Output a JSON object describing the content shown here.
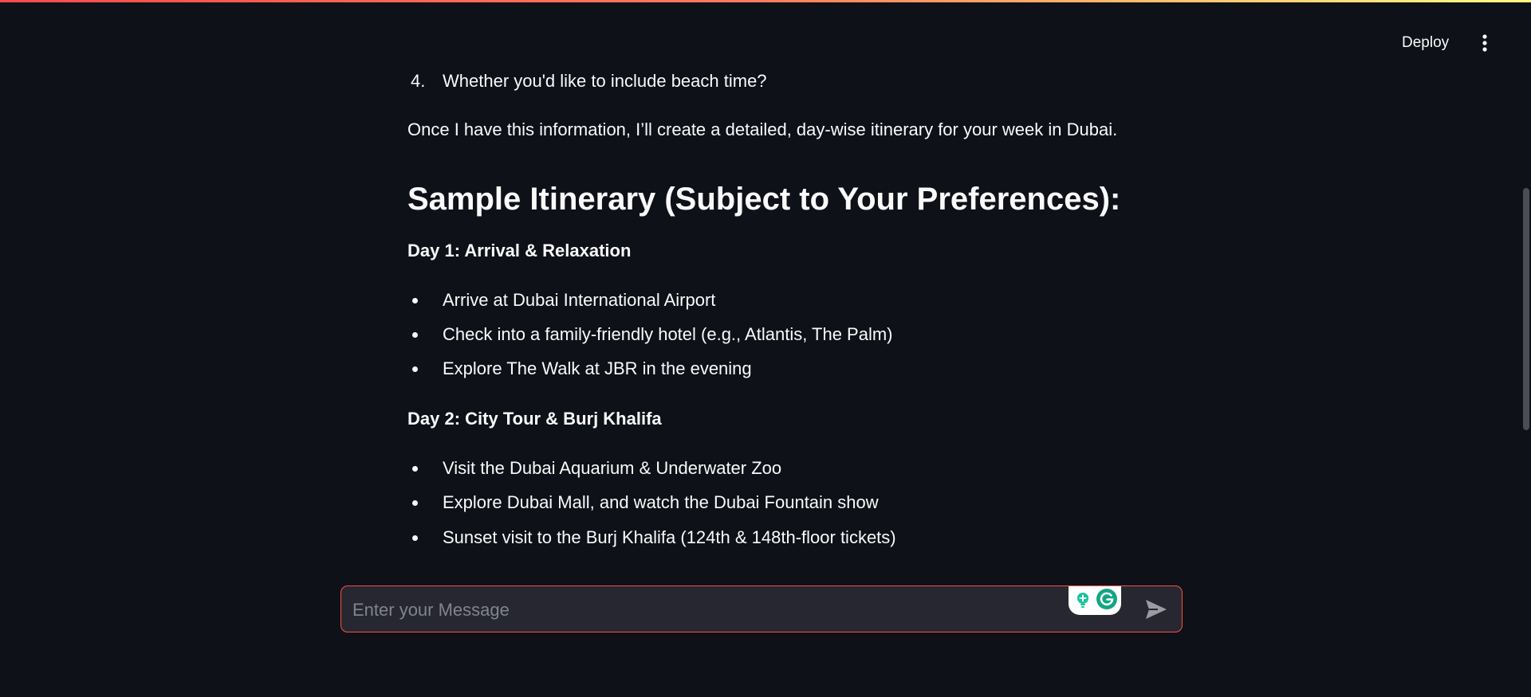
{
  "header": {
    "deploy_label": "Deploy",
    "menu_icon": "vertical-ellipsis-icon"
  },
  "colors": {
    "background": "#0e1117",
    "text": "#fafafa",
    "accent": "#ff4b4b",
    "input_bg": "#262730",
    "placeholder": "#80848e"
  },
  "chat": {
    "ordered_item": {
      "number": "4.",
      "text": "Whether you'd like to include beach time?"
    },
    "intro_paragraph": "Once I have this information, I’ll create a detailed, day-wise itinerary for your week in Dubai.",
    "section_heading": "Sample Itinerary (Subject to Your Preferences):",
    "days": [
      {
        "heading": "Day 1: Arrival & Relaxation",
        "items": [
          "Arrive at Dubai International Airport",
          "Check into a family-friendly hotel (e.g., Atlantis, The Palm)",
          "Explore The Walk at JBR in the evening"
        ]
      },
      {
        "heading": "Day 2: City Tour & Burj Khalifa",
        "items": [
          "Visit the Dubai Aquarium & Underwater Zoo",
          "Explore Dubai Mall, and watch the Dubai Fountain show",
          "Sunset visit to the Burj Khalifa (124th & 148th-floor tickets)"
        ]
      }
    ]
  },
  "input": {
    "placeholder": "Enter your Message",
    "value": "",
    "send_icon": "send-icon",
    "extension_icons": [
      "lightbulb-icon",
      "grammarly-icon"
    ]
  }
}
